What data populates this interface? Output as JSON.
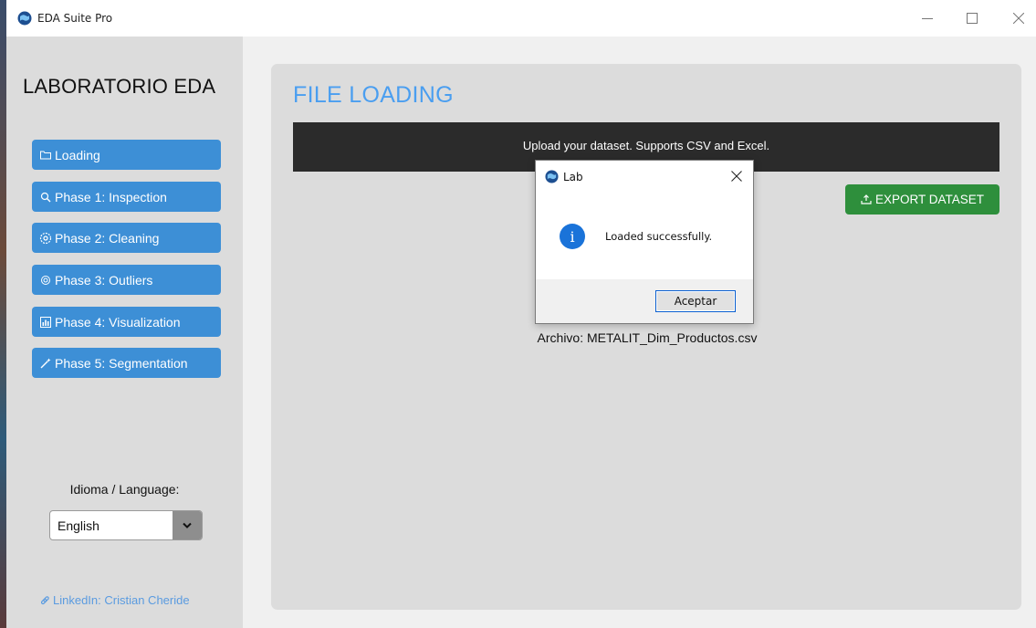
{
  "window": {
    "title": "EDA Suite Pro",
    "icon": "globe-app-icon"
  },
  "sidebar": {
    "title": "LABORATORIO EDA",
    "items": [
      {
        "label": "Loading",
        "icon": "folder-icon"
      },
      {
        "label": "Phase 1: Inspection",
        "icon": "magnifier-icon"
      },
      {
        "label": "Phase 2: Cleaning",
        "icon": "gear-icon"
      },
      {
        "label": "Phase 3: Outliers",
        "icon": "target-icon"
      },
      {
        "label": "Phase 4: Visualization",
        "icon": "bar-chart-icon"
      },
      {
        "label": "Phase 5: Segmentation",
        "icon": "magic-wand-icon"
      }
    ],
    "language_label": "Idioma / Language:",
    "language_selected": "English",
    "linkedin_label": "LinkedIn: Cristian Cheride"
  },
  "main": {
    "title": "FILE LOADING",
    "banner_text": "Upload your dataset. Supports CSV and Excel.",
    "export_label": "EXPORT DATASET",
    "file_label": "Archivo: METALIT_Dim_Productos.csv"
  },
  "dialog": {
    "title": "Lab",
    "message": "Loaded successfully.",
    "ok_label": "Aceptar"
  },
  "colors": {
    "nav_button": "#3d8fd6",
    "export_button": "#2e8f3c",
    "title_accent": "#4a9ef0",
    "banner_bg": "#2b2b2b",
    "panel_bg": "#dcdcdc"
  }
}
